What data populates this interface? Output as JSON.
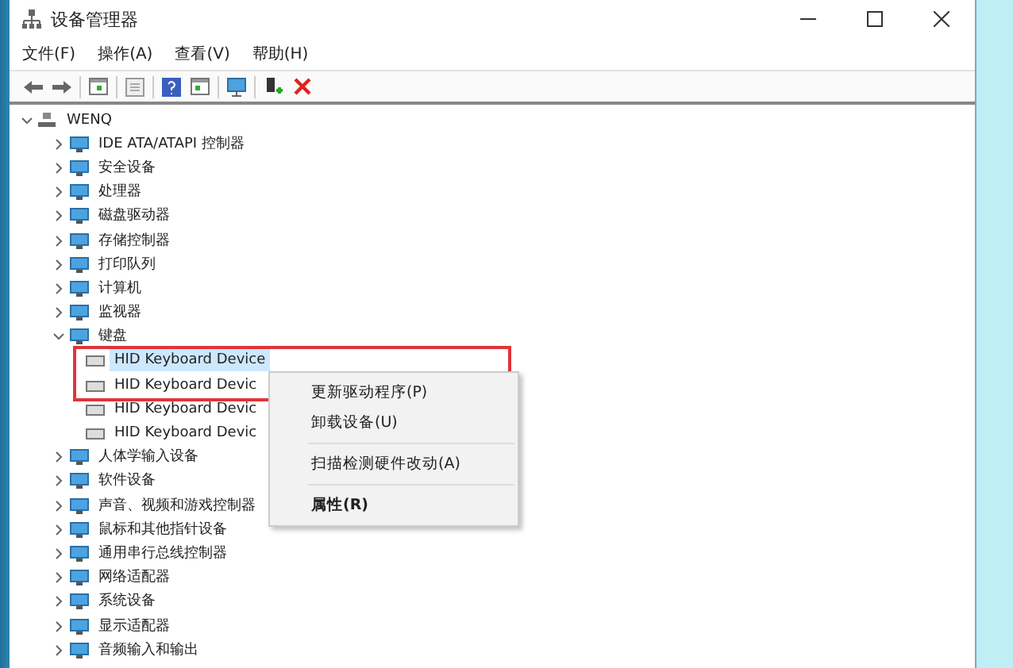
{
  "window": {
    "title": "设备管理器"
  },
  "menu": [
    "文件(F)",
    "操作(A)",
    "查看(V)",
    "帮助(H)"
  ],
  "tree": {
    "label": "WENQ",
    "expanded": true,
    "children": [
      {
        "label": "IDE ATA/ATAPI 控制器",
        "expanded": false,
        "selected": false
      },
      {
        "label": "安全设备",
        "expanded": false,
        "selected": false
      },
      {
        "label": "处理器",
        "expanded": false,
        "selected": false
      },
      {
        "label": "磁盘驱动器",
        "expanded": false,
        "selected": false
      },
      {
        "label": "存储控制器",
        "expanded": false,
        "selected": false
      },
      {
        "label": "打印队列",
        "expanded": false,
        "selected": false
      },
      {
        "label": "计算机",
        "expanded": false,
        "selected": false
      },
      {
        "label": "监视器",
        "expanded": false,
        "selected": false
      },
      {
        "label": "键盘",
        "expanded": true,
        "selected": false,
        "children": [
          {
            "label": "HID Keyboard Device",
            "selected": true
          },
          {
            "label": "HID Keyboard Devic",
            "selected": false
          },
          {
            "label": "HID Keyboard Devic",
            "selected": false
          },
          {
            "label": "HID Keyboard Devic",
            "selected": false
          }
        ]
      },
      {
        "label": "人体学输入设备",
        "expanded": false,
        "selected": false
      },
      {
        "label": "软件设备",
        "expanded": false,
        "selected": false
      },
      {
        "label": "声音、视频和游戏控制器",
        "expanded": false,
        "selected": false
      },
      {
        "label": "鼠标和其他指针设备",
        "expanded": false,
        "selected": false
      },
      {
        "label": "通用串行总线控制器",
        "expanded": false,
        "selected": false
      },
      {
        "label": "网络适配器",
        "expanded": false,
        "selected": false
      },
      {
        "label": "系统设备",
        "expanded": false,
        "selected": false
      },
      {
        "label": "显示适配器",
        "expanded": false,
        "selected": false
      },
      {
        "label": "音频输入和输出",
        "expanded": false,
        "selected": false
      }
    ]
  },
  "context_menu": [
    {
      "kind": "item",
      "label": "更新驱动程序(P)",
      "bold": false
    },
    {
      "kind": "item",
      "label": "卸载设备(U)",
      "bold": false
    },
    {
      "kind": "separator"
    },
    {
      "kind": "item",
      "label": "扫描检测硬件改动(A)",
      "bold": false
    },
    {
      "kind": "separator"
    },
    {
      "kind": "item",
      "label": "属性(R)",
      "bold": true
    }
  ]
}
